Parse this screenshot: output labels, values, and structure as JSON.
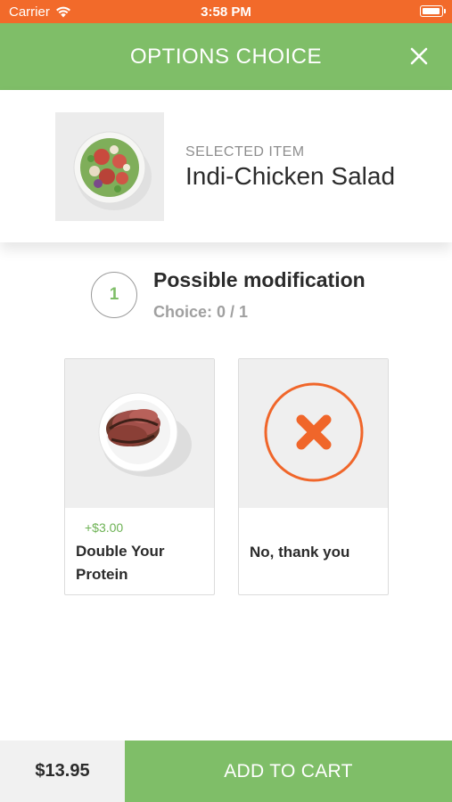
{
  "status_bar": {
    "carrier": "Carrier",
    "time": "3:58 PM"
  },
  "header": {
    "title": "OPTIONS CHOICE",
    "close_icon": "close-icon"
  },
  "selected_item": {
    "label": "SELECTED ITEM",
    "name": "Indi-Chicken Salad",
    "image": "salad-image"
  },
  "modification": {
    "step": "1",
    "title": "Possible modification",
    "choice": "Choice: 0 / 1"
  },
  "options": [
    {
      "price": "+$3.00",
      "name_line1": "Double Your",
      "name_line2": "Protein",
      "image": "steak-image"
    },
    {
      "name": "No, thank you",
      "image": "cancel-x-icon"
    }
  ],
  "footer": {
    "total": "$13.95",
    "add_to_cart": "ADD TO CART"
  },
  "colors": {
    "status_bar": "#f26a2a",
    "brand_green": "#7fbe68",
    "accent_orange": "#f0662a"
  }
}
